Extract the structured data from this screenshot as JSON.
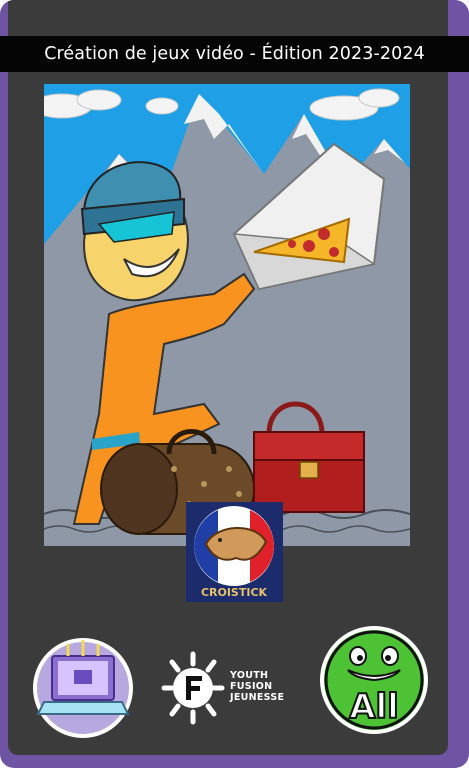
{
  "banner": {
    "title": "Création de jeux vidéo - Édition 2023-2024"
  },
  "badge": {
    "text": "CROISTICK"
  },
  "logos": {
    "youth_fusion": {
      "line1": "YOUTH",
      "line2": "FUSION",
      "line3": "JEUNESSE"
    },
    "all": {
      "text": "All"
    }
  },
  "colors": {
    "frame": "#6e54a3",
    "panel": "#3b3b3b",
    "banner": "#050505",
    "sky": "#1fa0e6",
    "mountain": "#8e98a6"
  },
  "icons": [
    "laptop-icon",
    "youth-fusion-logo",
    "all-monster-logo",
    "croistick-badge"
  ]
}
